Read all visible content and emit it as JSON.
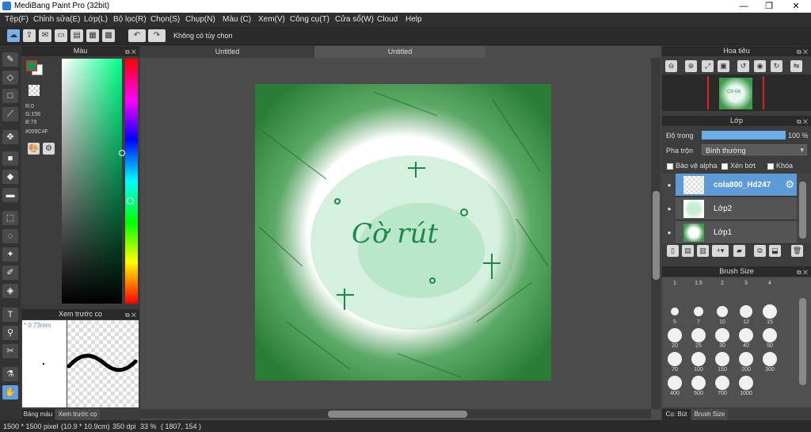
{
  "window": {
    "title": "MediBang Paint Pro (32bit)",
    "min": "—",
    "max": "❐",
    "close": "✕"
  },
  "menu": [
    "Tệp(F)",
    "Chỉnh sửa(E)",
    "Lớp(L)",
    "Bộ lọc(R)",
    "Chọn(S)",
    "Chụp(N)",
    "Màu (C)",
    "Xem(V)",
    "Công cụ(T)",
    "Cửa sổ(W)",
    "Cloud",
    "Help"
  ],
  "toolbar": {
    "selection_text": "Không có tùy chọn"
  },
  "color_panel": {
    "title": "Màu",
    "r": "R:0",
    "g": "G:156",
    "b": "B:79",
    "hex": "#009C4F",
    "fg": "#009c4f",
    "bg": "#ffffff"
  },
  "brush_preview": {
    "title": "Xem trước cọ",
    "size": "* 0.73mm"
  },
  "bottom_tabs_left": [
    "Bảng màu",
    "Xem trước cọ"
  ],
  "document_tabs": [
    "Untitled",
    "Untitled"
  ],
  "canvas": {
    "text": "Cờ rút"
  },
  "navigator": {
    "title": "Hoa tiêu",
    "thumb_text": "Cờ rút"
  },
  "layers": {
    "title": "Lớp",
    "opacity_label": "Độ trong",
    "opacity_value": "100 %",
    "opacity_fraction": 1.0,
    "blend_label": "Pha trộn",
    "blend_value": "Bình thường",
    "protect_alpha": "Bảo vệ alpha",
    "clipping": "Xén bớt",
    "lock": "Khóa",
    "items": [
      {
        "name": "cola800_Hd247",
        "selected": true
      },
      {
        "name": "Lớp2",
        "selected": false
      },
      {
        "name": "Lớp1",
        "selected": false
      }
    ]
  },
  "brush_size": {
    "title": "Brush Size",
    "sizes": [
      "1",
      "1.5",
      "2",
      "3",
      "4",
      "5",
      "7",
      "10",
      "12",
      "15",
      "20",
      "25",
      "30",
      "40",
      "50",
      "70",
      "100",
      "150",
      "200",
      "300",
      "400",
      "500",
      "700",
      "1000"
    ]
  },
  "bottom_tabs_right": [
    "Cọ: Bút",
    "Brush Size"
  ],
  "status": {
    "dimensions": "1500 * 1500 pixel",
    "physical": "(10.9 * 10.9cm)",
    "dpi": "350 dpi",
    "zoom": "33 %",
    "coords": "( 1807, 154 )"
  }
}
